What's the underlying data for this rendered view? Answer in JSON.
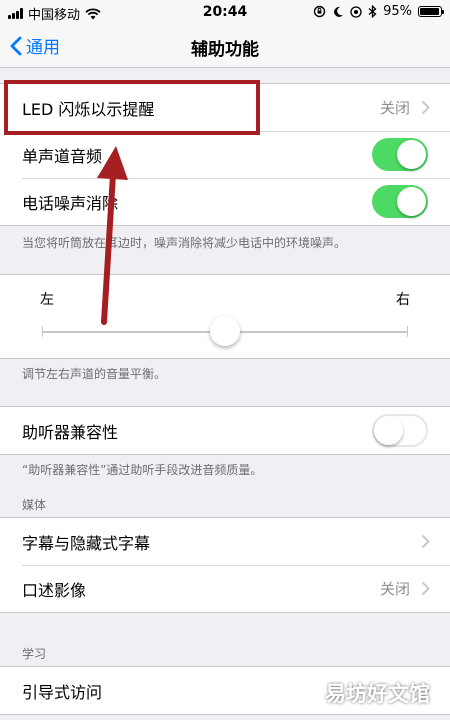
{
  "status_bar": {
    "carrier": "中国移动",
    "time": "20:44",
    "battery_percent": "95%",
    "battery_level": 0.95
  },
  "nav": {
    "back_label": "通用",
    "title": "辅助功能"
  },
  "colors": {
    "accent": "#007aff",
    "toggle_on": "#4cd964",
    "highlight": "#a51e22"
  },
  "rows": {
    "led": {
      "label": "LED 闪烁以示提醒",
      "value": "关闭"
    },
    "mono": {
      "label": "单声道音频",
      "state": "on"
    },
    "noise": {
      "label": "电话噪声消除",
      "state": "on"
    },
    "hearing": {
      "label": "助听器兼容性",
      "state": "off"
    },
    "subtitles": {
      "label": "字幕与隐藏式字幕"
    },
    "audio_desc": {
      "label": "口述影像",
      "value": "关闭"
    },
    "guided": {
      "label": "引导式访问"
    }
  },
  "footers": {
    "noise_note": "当您将听筒放在耳边时，噪声消除将减少电话中的环境噪声。",
    "balance_note": "调节左右声道的音量平衡。",
    "hearing_note": "“助听器兼容性”通过助听手段改进音频质量。"
  },
  "balance": {
    "left_label": "左",
    "right_label": "右",
    "level": 0.5
  },
  "sections": {
    "media": "媒体",
    "learning": "学习"
  },
  "watermark": "易坊好文馆"
}
